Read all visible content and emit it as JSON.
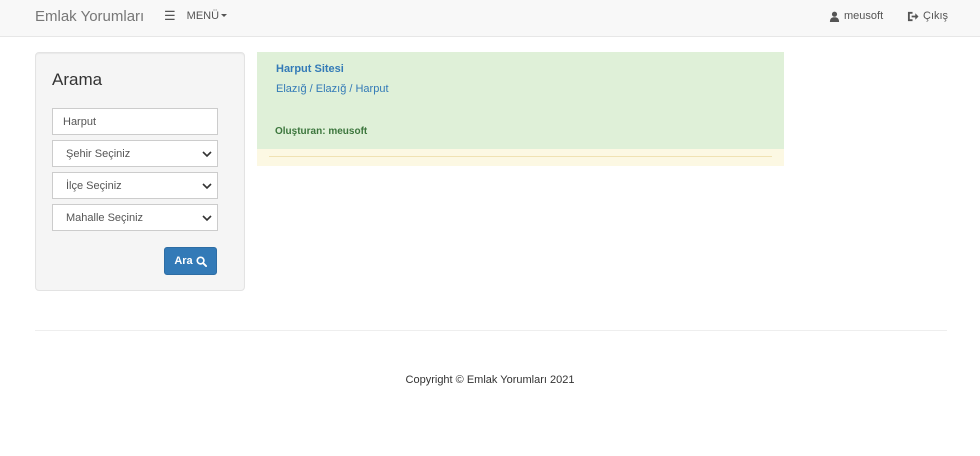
{
  "navbar": {
    "brand": "Emlak Yorumları",
    "menu_icon": "hamburger-icon",
    "menu_label": "MENÜ",
    "user_icon": "user-icon",
    "user_label": "meusoft",
    "logout_icon": "logout-icon",
    "logout_label": "Çıkış"
  },
  "search": {
    "title": "Arama",
    "query_value": "Harput",
    "city_select": "Şehir Seçiniz",
    "district_select": "İlçe Seçiniz",
    "neighborhood_select": "Mahalle Seçiniz",
    "submit_label": "Ara",
    "submit_icon": "search-icon"
  },
  "result": {
    "title": "Harput Sitesi",
    "path": "Elazığ / Elazığ / Harput",
    "owner": "Oluşturan: meusoft"
  },
  "footer": {
    "copyright": "Copyright © Emlak Yorumları 2021"
  },
  "colors": {
    "primary": "#337ab7",
    "success_bg": "#dff0d8",
    "success_text": "#3c763d",
    "warning_bg": "#fcf8e3",
    "navbar_bg": "#f8f8f8"
  }
}
